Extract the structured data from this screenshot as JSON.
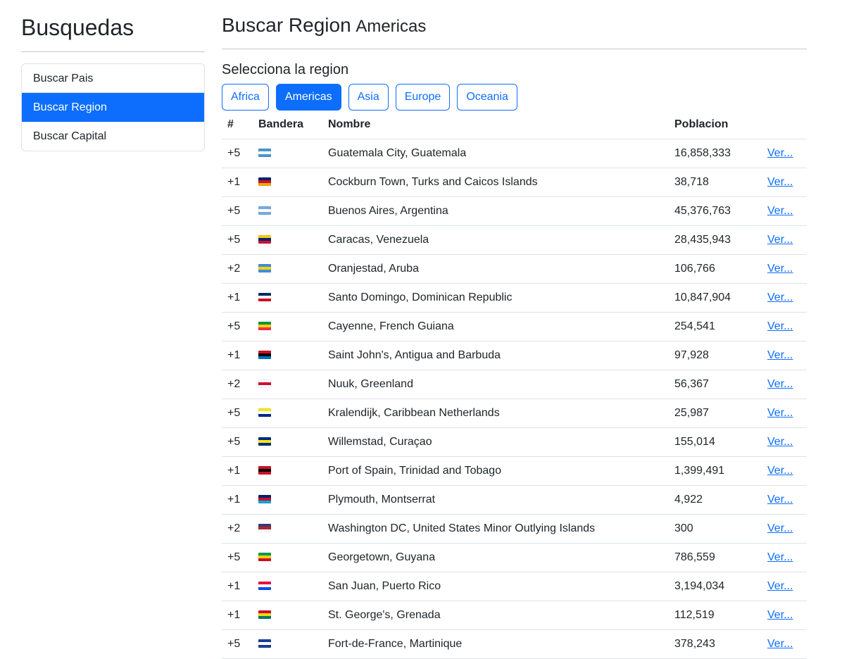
{
  "sidebar": {
    "title": "Busquedas",
    "items": [
      {
        "label": "Buscar Pais",
        "active": false
      },
      {
        "label": "Buscar Region",
        "active": true
      },
      {
        "label": "Buscar Capital",
        "active": false
      }
    ]
  },
  "main": {
    "title": "Buscar Region",
    "subtitle": "Americas",
    "select_label": "Selecciona la region",
    "regions": [
      {
        "label": "Africa",
        "active": false
      },
      {
        "label": "Americas",
        "active": true
      },
      {
        "label": "Asia",
        "active": false
      },
      {
        "label": "Europe",
        "active": false
      },
      {
        "label": "Oceania",
        "active": false
      }
    ],
    "table": {
      "headers": [
        "#",
        "Bandera",
        "Nombre",
        "Poblacion",
        ""
      ],
      "link_label": "Ver...",
      "rows": [
        {
          "num": "+5",
          "flag": "Guatemala flag",
          "flag_colors": [
            "#4997d0",
            "#ffffff",
            "#4997d0"
          ],
          "name": "Guatemala City, Guatemala",
          "population": "16,858,333"
        },
        {
          "num": "+1",
          "flag": "Turks and Caicos Islands flag",
          "flag_colors": [
            "#012169",
            "#c8102e",
            "#f2a900"
          ],
          "name": "Cockburn Town, Turks and Caicos Islands",
          "population": "38,718"
        },
        {
          "num": "+5",
          "flag": "Argentina flag",
          "flag_colors": [
            "#74acdf",
            "#ffffff",
            "#74acdf"
          ],
          "name": "Buenos Aires, Argentina",
          "population": "45,376,763"
        },
        {
          "num": "+5",
          "flag": "Venezuela flag",
          "flag_colors": [
            "#ffcc00",
            "#00247d",
            "#cf142b"
          ],
          "name": "Caracas, Venezuela",
          "population": "28,435,943"
        },
        {
          "num": "+2",
          "flag": "Aruba flag",
          "flag_colors": [
            "#418fde",
            "#ffd100",
            "#418fde"
          ],
          "name": "Oranjestad, Aruba",
          "population": "106,766"
        },
        {
          "num": "+1",
          "flag": "Dominican Republic flag",
          "flag_colors": [
            "#002d62",
            "#ffffff",
            "#ce1126"
          ],
          "name": "Santo Domingo, Dominican Republic",
          "population": "10,847,904"
        },
        {
          "num": "+5",
          "flag": "French Guiana flag",
          "flag_colors": [
            "#009639",
            "#fcd116",
            "#ef3340"
          ],
          "name": "Cayenne, French Guiana",
          "population": "254,541"
        },
        {
          "num": "+1",
          "flag": "Antigua and Barbuda flag",
          "flag_colors": [
            "#ce1126",
            "#000000",
            "#0072c6"
          ],
          "name": "Saint John's, Antigua and Barbuda",
          "population": "97,928"
        },
        {
          "num": "+2",
          "flag": "Greenland flag",
          "flag_colors": [
            "#ffffff",
            "#d00c33",
            "#ffffff"
          ],
          "name": "Nuuk, Greenland",
          "population": "56,367"
        },
        {
          "num": "+5",
          "flag": "Caribbean Netherlands flag",
          "flag_colors": [
            "#f9e814",
            "#ffffff",
            "#012a87"
          ],
          "name": "Kralendijk, Caribbean Netherlands",
          "population": "25,987"
        },
        {
          "num": "+5",
          "flag": "Curacao flag",
          "flag_colors": [
            "#002b7f",
            "#f9e814",
            "#002b7f"
          ],
          "name": "Willemstad, Curaçao",
          "population": "155,014"
        },
        {
          "num": "+1",
          "flag": "Trinidad and Tobago flag",
          "flag_colors": [
            "#ce1126",
            "#000000",
            "#ce1126"
          ],
          "name": "Port of Spain, Trinidad and Tobago",
          "population": "1,399,491"
        },
        {
          "num": "+1",
          "flag": "Montserrat flag",
          "flag_colors": [
            "#012169",
            "#c8102e",
            "#00a6d6"
          ],
          "name": "Plymouth, Montserrat",
          "population": "4,922"
        },
        {
          "num": "+2",
          "flag": "United States Minor Outlying Islands flag",
          "flag_colors": [
            "#3c3b6e",
            "#b22234",
            "#ffffff"
          ],
          "name": "Washington DC, United States Minor Outlying Islands",
          "population": "300"
        },
        {
          "num": "+5",
          "flag": "Guyana flag",
          "flag_colors": [
            "#009e49",
            "#fcd116",
            "#ce1126"
          ],
          "name": "Georgetown, Guyana",
          "population": "786,559"
        },
        {
          "num": "+1",
          "flag": "Puerto Rico flag",
          "flag_colors": [
            "#ed0a3f",
            "#ffffff",
            "#0050f0"
          ],
          "name": "San Juan, Puerto Rico",
          "population": "3,194,034"
        },
        {
          "num": "+1",
          "flag": "Grenada flag",
          "flag_colors": [
            "#ce1126",
            "#fcd116",
            "#007a5e"
          ],
          "name": "St. George's, Grenada",
          "population": "112,519"
        },
        {
          "num": "+5",
          "flag": "Martinique flag",
          "flag_colors": [
            "#1b3f91",
            "#ffffff",
            "#1b3f91"
          ],
          "name": "Fort-de-France, Martinique",
          "population": "378,243"
        }
      ]
    }
  },
  "colors": {
    "primary": "#0d6efd",
    "border": "#dee2e6",
    "text": "#212529"
  }
}
